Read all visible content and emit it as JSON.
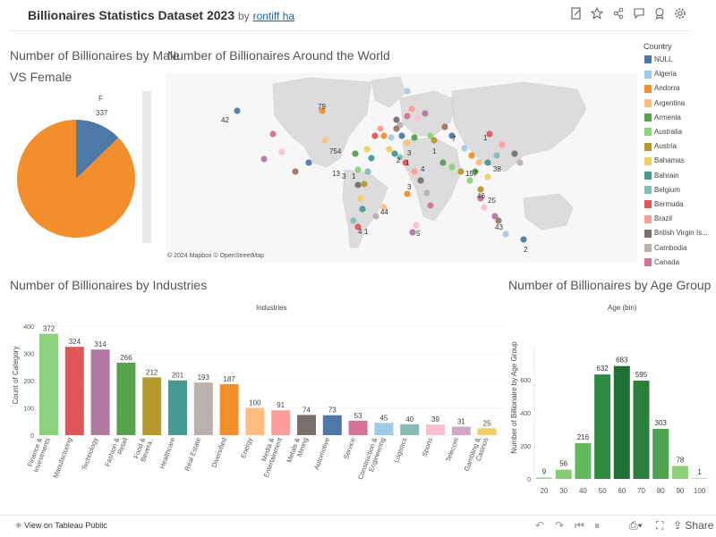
{
  "header": {
    "title": "Billionaires Statistics Dataset 2023",
    "by": "by",
    "author": "rontiff ha"
  },
  "pie": {
    "title_line1": "Number of Billionaires by Male",
    "title_line2": "VS Female",
    "label_f": "F",
    "label_f_value": "337"
  },
  "map": {
    "title": "Number of Billionaires Around the World",
    "attribution": "© 2024 Mapbox  © OpenStreetMap",
    "labels": [
      "42",
      "79",
      "754",
      "13",
      "3",
      "1",
      "44",
      "4",
      "1",
      "2",
      "1",
      "3",
      "4",
      "1",
      "7",
      "157",
      "1",
      "38",
      "46",
      "25",
      "3",
      "5",
      "43",
      "2"
    ]
  },
  "legend": {
    "title": "Country",
    "items": [
      {
        "name": "NULL",
        "color": "#4e79a7"
      },
      {
        "name": "Algeria",
        "color": "#a0cbe8"
      },
      {
        "name": "Andorra",
        "color": "#f28e2b"
      },
      {
        "name": "Argentina",
        "color": "#ffbe7d"
      },
      {
        "name": "Armenia",
        "color": "#59a14f"
      },
      {
        "name": "Australia",
        "color": "#8cd17d"
      },
      {
        "name": "Austria",
        "color": "#b6992d"
      },
      {
        "name": "Bahamas",
        "color": "#f1ce63"
      },
      {
        "name": "Bahrain",
        "color": "#499894"
      },
      {
        "name": "Belgium",
        "color": "#86bcb6"
      },
      {
        "name": "Bermuda",
        "color": "#e15759"
      },
      {
        "name": "Brazil",
        "color": "#ff9d9a"
      },
      {
        "name": "British Virgin Is...",
        "color": "#79706e"
      },
      {
        "name": "Cambodia",
        "color": "#bab0ac"
      },
      {
        "name": "Canada",
        "color": "#d37295"
      }
    ]
  },
  "industries": {
    "title": "Number of Billionaires by Industries",
    "header": "Industries",
    "ylabel": "Count of Category"
  },
  "age": {
    "title": "Number of Billionaires by Age Group",
    "header": "Age (bin)",
    "ylabel": "Number of Billionaire by Age Group"
  },
  "footer": {
    "view_label": "View on Tableau Public"
  },
  "chart_data": [
    {
      "type": "pie",
      "categories": [
        "F",
        "M"
      ],
      "values": [
        337,
        2303
      ],
      "colors": [
        "#4e79a7",
        "#f28e2b"
      ]
    },
    {
      "type": "bar",
      "categories": [
        "Finance & Investments",
        "Manufacturing",
        "Technology",
        "Fashion & Retail",
        "Food & Bevera..",
        "Healthcare",
        "Real Estate",
        "Diversified",
        "Energy",
        "Media & Entertainment",
        "Metals & Mining",
        "Automotive",
        "Service",
        "Construction & Engineering",
        "Logistics",
        "Sports",
        "Telecom",
        "Gambling & Casinos"
      ],
      "values": [
        372,
        324,
        314,
        266,
        212,
        201,
        193,
        187,
        100,
        91,
        74,
        73,
        53,
        45,
        40,
        39,
        31,
        25
      ],
      "colors": [
        "#8cd17d",
        "#e15759",
        "#b07aa1",
        "#59a14f",
        "#b6992d",
        "#499894",
        "#bab0ac",
        "#f28e2b",
        "#ffbe7d",
        "#ff9d9a",
        "#79706e",
        "#4e79a7",
        "#d37295",
        "#a0cbe8",
        "#86bcb6",
        "#fabfd2",
        "#d4a6c8",
        "#f1ce63"
      ],
      "ylim": [
        0,
        400
      ],
      "yticks": [
        0,
        100,
        200,
        300,
        400
      ]
    },
    {
      "type": "bar",
      "categories": [
        "20",
        "30",
        "40",
        "50",
        "60",
        "70",
        "80",
        "90",
        "100"
      ],
      "values": [
        9,
        56,
        216,
        632,
        683,
        595,
        303,
        78,
        1
      ],
      "colors": [
        "#9fd88a",
        "#86cd74",
        "#62b660",
        "#2e8a3e",
        "#1f6e34",
        "#2a803b",
        "#4ea34f",
        "#8ad175",
        "#a9dd96"
      ],
      "ylim": [
        0,
        800
      ],
      "yticks": [
        0,
        200,
        400,
        600
      ]
    }
  ]
}
